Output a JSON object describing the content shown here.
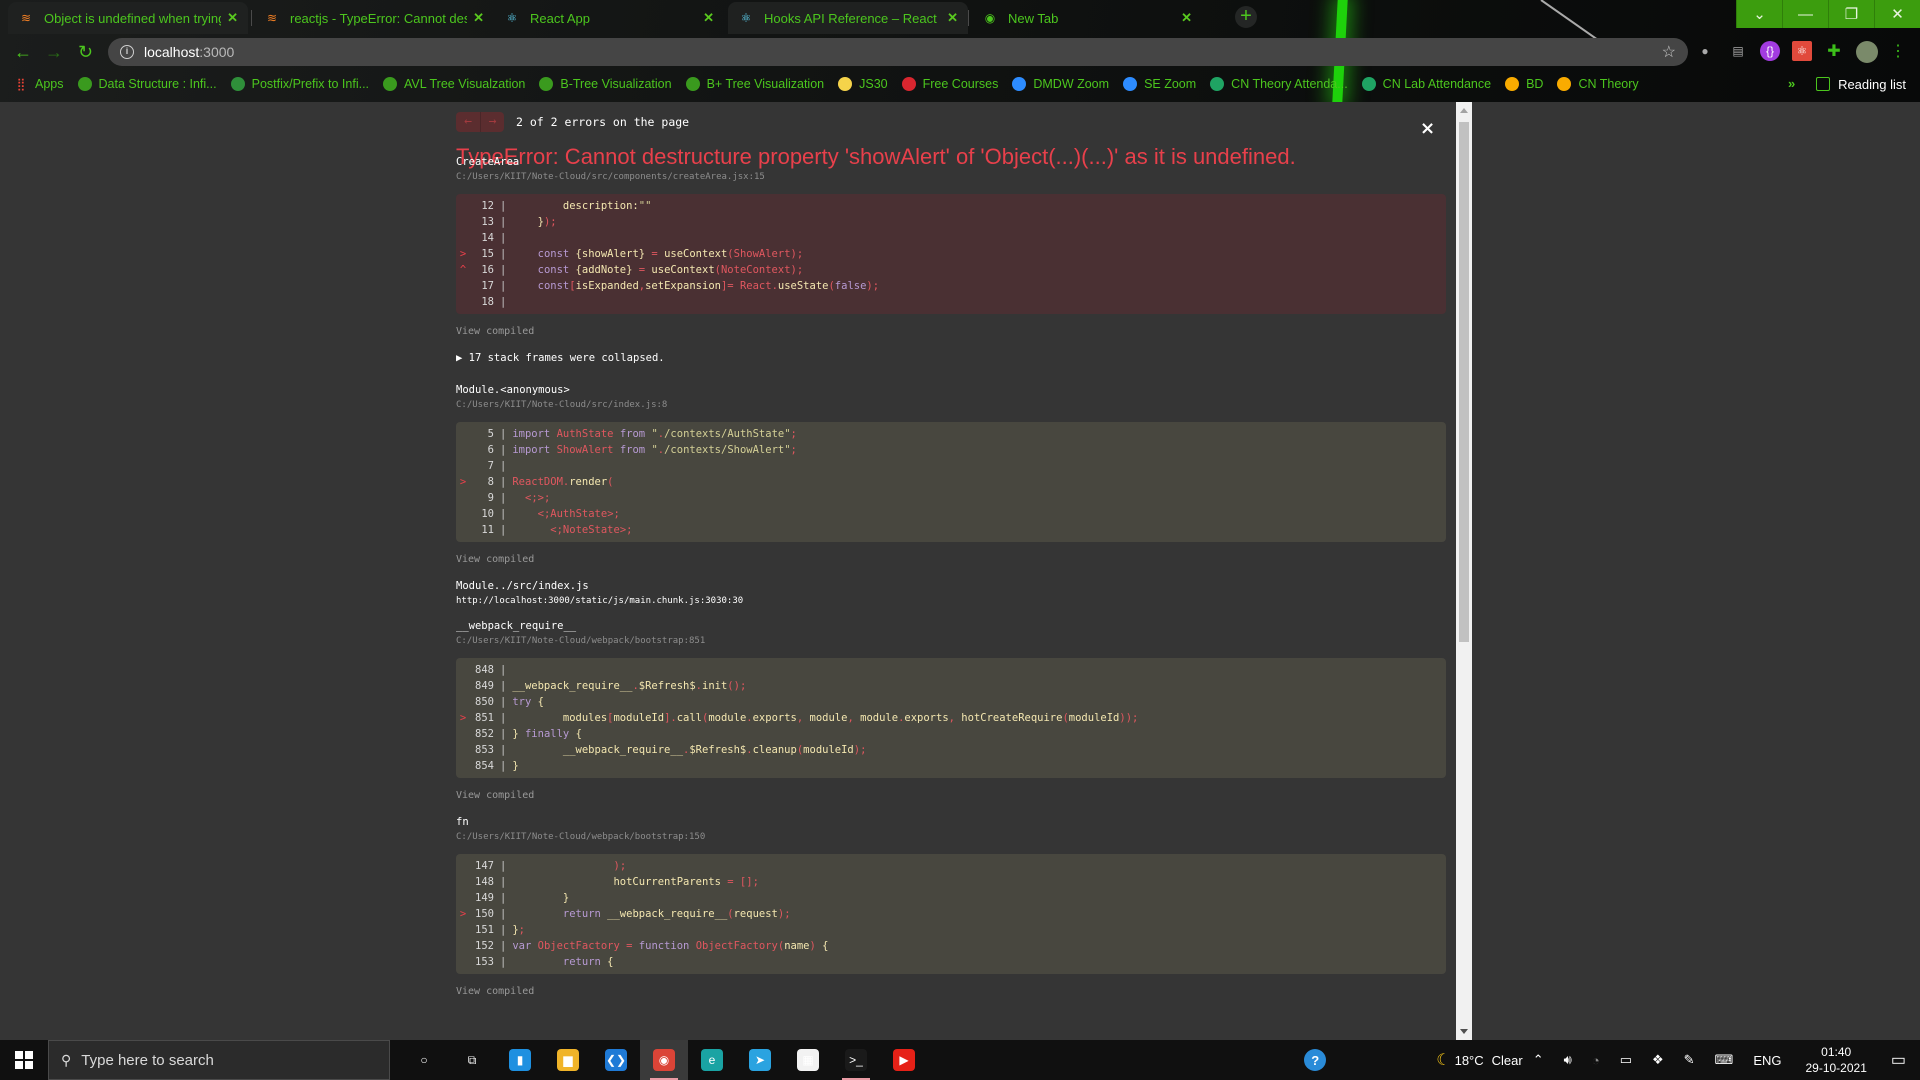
{
  "browser": {
    "tabs": [
      {
        "title": "Object is undefined when trying t",
        "favicon": "stackoverflow-icon",
        "active": true
      },
      {
        "title": "reactjs - TypeError: Cannot destru",
        "favicon": "stackoverflow-icon",
        "active": false
      },
      {
        "title": "React App",
        "favicon": "react-icon",
        "active": false
      },
      {
        "title": "Hooks API Reference – React",
        "favicon": "react-icon",
        "active": true
      },
      {
        "title": "New Tab",
        "favicon": "chrome-icon",
        "active": false
      }
    ],
    "new_tab_label": "+",
    "address": {
      "host": "localhost",
      "port": ":3000"
    },
    "window_controls": {
      "dropdown": "⌄",
      "minimize": "—",
      "restore": "❐",
      "close": "✕"
    },
    "bookmarks": [
      {
        "label": "Apps",
        "icon": "apps-grid-icon",
        "color": "#e94235"
      },
      {
        "label": "Data Structure : Infi...",
        "icon": "globe-icon",
        "color": "#3a9a1e"
      },
      {
        "label": "Postfix/Prefix to Infi...",
        "icon": "sheet-icon",
        "color": "#2f8f3a"
      },
      {
        "label": "AVL Tree Visualzation",
        "icon": "globe-icon",
        "color": "#3a9a1e"
      },
      {
        "label": "B-Tree Visualization",
        "icon": "globe-icon",
        "color": "#3a9a1e"
      },
      {
        "label": "B+ Tree Visualization",
        "icon": "globe-icon",
        "color": "#3a9a1e"
      },
      {
        "label": "JS30",
        "icon": "crown-icon",
        "color": "#f5d34a"
      },
      {
        "label": "Free Courses",
        "icon": "m-icon",
        "color": "#d9262f"
      },
      {
        "label": "DMDW Zoom",
        "icon": "zoom-icon",
        "color": "#2d8cff"
      },
      {
        "label": "SE Zoom",
        "icon": "zoom-icon",
        "color": "#2d8cff"
      },
      {
        "label": "CN Theory Attenda...",
        "icon": "sheets-icon",
        "color": "#1fa463"
      },
      {
        "label": "CN Lab Attendance",
        "icon": "sheets-icon",
        "color": "#1fa463"
      },
      {
        "label": "BD",
        "icon": "meet-icon",
        "color": "#f9ab00"
      },
      {
        "label": "CN Theory",
        "icon": "meet-icon",
        "color": "#f9ab00"
      }
    ],
    "more_bookmarks": "»",
    "reading_list": "Reading list"
  },
  "overlay": {
    "nav_prev": "←",
    "nav_next": "→",
    "error_count": "2 of 2 errors on the page",
    "close": "×",
    "title": "TypeError: Cannot destructure property 'showAlert' of 'Object(...)(...)' as it is undefined.",
    "view_compiled": "View compiled",
    "collapsed": "▶ 17 stack frames were collapsed.",
    "frames": [
      {
        "name": "CreateArea",
        "location": "C:/Users/KIIT/Note-Cloud/src/components/createArea.jsx:15",
        "error": true,
        "lines": [
          {
            "n": "12",
            "mark": "",
            "code": "        description:\"\""
          },
          {
            "n": "13",
            "mark": "",
            "code": "    });"
          },
          {
            "n": "14",
            "mark": "",
            "code": ""
          },
          {
            "n": "15",
            "mark": ">",
            "code": "    const {showAlert} = useContext(ShowAlert);"
          },
          {
            "n": "16",
            "mark": "^",
            "code": "    const {addNote} = useContext(NoteContext);"
          },
          {
            "n": "17",
            "mark": "",
            "code": "    const[isExpanded,setExpansion]= React.useState(false);"
          },
          {
            "n": "18",
            "mark": "",
            "code": ""
          }
        ]
      },
      {
        "name": "Module.<anonymous>",
        "location": "C:/Users/KIIT/Note-Cloud/src/index.js:8",
        "error": false,
        "lines": [
          {
            "n": "5",
            "mark": "",
            "code": "import AuthState from \"./contexts/AuthState\";"
          },
          {
            "n": "6",
            "mark": "",
            "code": "import ShowAlert from \"./contexts/ShowAlert\";"
          },
          {
            "n": "7",
            "mark": "",
            "code": ""
          },
          {
            "n": "8",
            "mark": ">",
            "code": "ReactDOM.render("
          },
          {
            "n": "9",
            "mark": "",
            "code": "  <>"
          },
          {
            "n": "10",
            "mark": "",
            "code": "    <AuthState>"
          },
          {
            "n": "11",
            "mark": "",
            "code": "      <NoteState>"
          }
        ]
      },
      {
        "name": "Module../src/index.js",
        "location": "http://localhost:3000/static/js/main.chunk.js:3030:30"
      },
      {
        "name": "__webpack_require__",
        "location": "C:/Users/KIIT/Note-Cloud/webpack/bootstrap:851",
        "error": false,
        "lines": [
          {
            "n": "848",
            "mark": "",
            "code": ""
          },
          {
            "n": "849",
            "mark": "",
            "code": "__webpack_require__.$Refresh$.init();"
          },
          {
            "n": "850",
            "mark": "",
            "code": "try {"
          },
          {
            "n": "851",
            "mark": ">",
            "code": "        modules[moduleId].call(module.exports, module, module.exports, hotCreateRequire(moduleId));"
          },
          {
            "n": "852",
            "mark": "",
            "code": "} finally {"
          },
          {
            "n": "853",
            "mark": "",
            "code": "        __webpack_require__.$Refresh$.cleanup(moduleId);"
          },
          {
            "n": "854",
            "mark": "",
            "code": "}"
          }
        ]
      },
      {
        "name": "fn",
        "location": "C:/Users/KIIT/Note-Cloud/webpack/bootstrap:150",
        "error": false,
        "lines": [
          {
            "n": "147",
            "mark": "",
            "code": "                );"
          },
          {
            "n": "148",
            "mark": "",
            "code": "                hotCurrentParents = [];"
          },
          {
            "n": "149",
            "mark": "",
            "code": "        }"
          },
          {
            "n": "150",
            "mark": ">",
            "code": "        return __webpack_require__(request);"
          },
          {
            "n": "151",
            "mark": "",
            "code": "};"
          },
          {
            "n": "152",
            "mark": "",
            "code": "var ObjectFactory = function ObjectFactory(name) {"
          },
          {
            "n": "153",
            "mark": "",
            "code": "        return {"
          }
        ]
      }
    ]
  },
  "taskbar": {
    "search_placeholder": "Type here to search",
    "apps": [
      {
        "name": "cortana",
        "glyph": "○",
        "color": "transparent"
      },
      {
        "name": "task-view",
        "glyph": "⧉",
        "color": "transparent"
      },
      {
        "name": "phone",
        "glyph": "▮",
        "color": "#1e90e0"
      },
      {
        "name": "file-explorer",
        "glyph": "▆",
        "color": "#f0b429"
      },
      {
        "name": "vscode",
        "glyph": "❮❯",
        "color": "#1f7ad6"
      },
      {
        "name": "chrome",
        "glyph": "◉",
        "color": "#db4437",
        "active": true
      },
      {
        "name": "edge",
        "glyph": "e",
        "color": "#1aa3a3"
      },
      {
        "name": "telegram",
        "glyph": "➤",
        "color": "#2aa3e0"
      },
      {
        "name": "store",
        "glyph": "▦",
        "color": "#f2f2f2"
      },
      {
        "name": "terminal",
        "glyph": ">_",
        "color": "#1a1a1a",
        "active_underline": true
      },
      {
        "name": "youtube",
        "glyph": "▶",
        "color": "#e62117"
      }
    ],
    "weather": {
      "temp": "18°C",
      "condition": "Clear"
    },
    "language": "ENG",
    "time": "01:40",
    "date": "29-10-2021"
  }
}
